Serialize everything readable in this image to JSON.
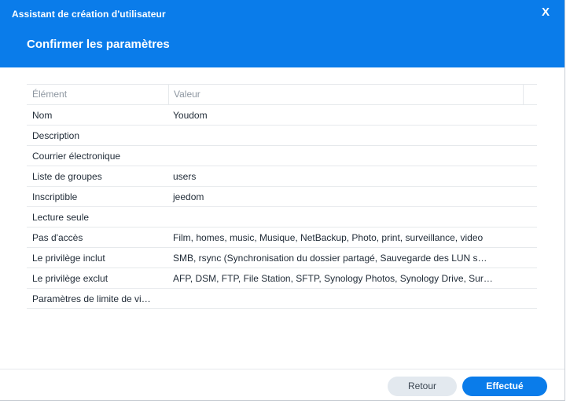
{
  "window": {
    "title": "Assistant de création d'utilisateur",
    "close_symbol": "X",
    "step_title": "Confirmer les paramètres"
  },
  "table": {
    "columns": [
      "Élément",
      "Valeur"
    ],
    "rows": [
      {
        "key": "Nom",
        "value": "Youdom"
      },
      {
        "key": "Description",
        "value": ""
      },
      {
        "key": "Courrier électronique",
        "value": ""
      },
      {
        "key": "Liste de groupes",
        "value": "users"
      },
      {
        "key": "Inscriptible",
        "value": "jeedom"
      },
      {
        "key": "Lecture seule",
        "value": ""
      },
      {
        "key": "Pas d'accès",
        "value": "Film, homes, music, Musique, NetBackup, Photo, print, surveillance, video"
      },
      {
        "key": "Le privilège inclut",
        "value": "SMB, rsync (Synchronisation du dossier partagé, Sauvegarde des LUN s…"
      },
      {
        "key": "Le privilège exclut",
        "value": "AFP, DSM, FTP, File Station, SFTP, Synology Photos, Synology Drive, Sur…"
      },
      {
        "key": "Paramètres de limite de vi…",
        "value": ""
      }
    ]
  },
  "footer": {
    "back_label": "Retour",
    "done_label": "Effectué"
  },
  "colors": {
    "header_bg": "#0a7cea",
    "primary_button": "#0a7cea",
    "secondary_button": "#e3e9ef"
  }
}
